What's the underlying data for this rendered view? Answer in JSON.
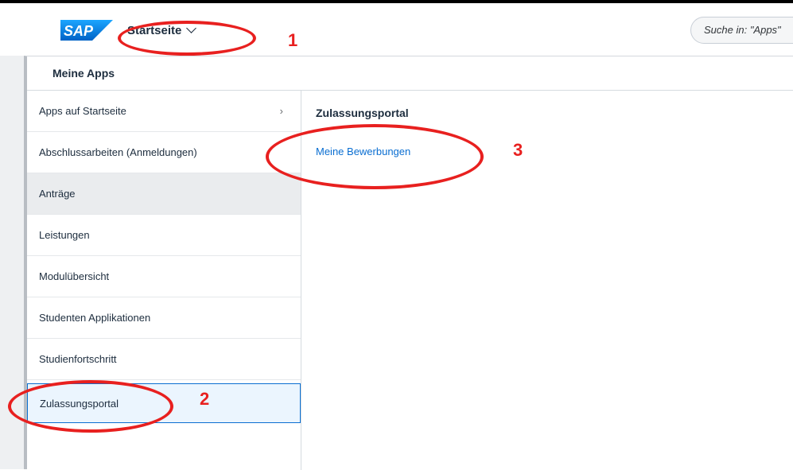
{
  "shell": {
    "logo_text": "SAP",
    "home_label": "Startseite",
    "search_placeholder": "Suche in: \"Apps\""
  },
  "popover": {
    "title": "Meine Apps"
  },
  "categories": [
    {
      "label": "Apps auf Startseite",
      "arrow": "›"
    },
    {
      "label": "Abschlussarbeiten (Anmeldungen)"
    },
    {
      "label": "Anträge"
    },
    {
      "label": "Leistungen"
    },
    {
      "label": "Modulübersicht"
    },
    {
      "label": "Studenten Applikationen"
    },
    {
      "label": "Studienfortschritt"
    },
    {
      "label": "Zulassungsportal"
    }
  ],
  "detail": {
    "title": "Zulassungsportal",
    "apps": [
      {
        "label": "Meine Bewerbungen"
      }
    ]
  },
  "annotations": {
    "one": "1",
    "two": "2",
    "three": "3"
  },
  "colors": {
    "annotation": "#e8201f",
    "link": "#0a6ed1",
    "sap_blue": "#0070f2"
  }
}
